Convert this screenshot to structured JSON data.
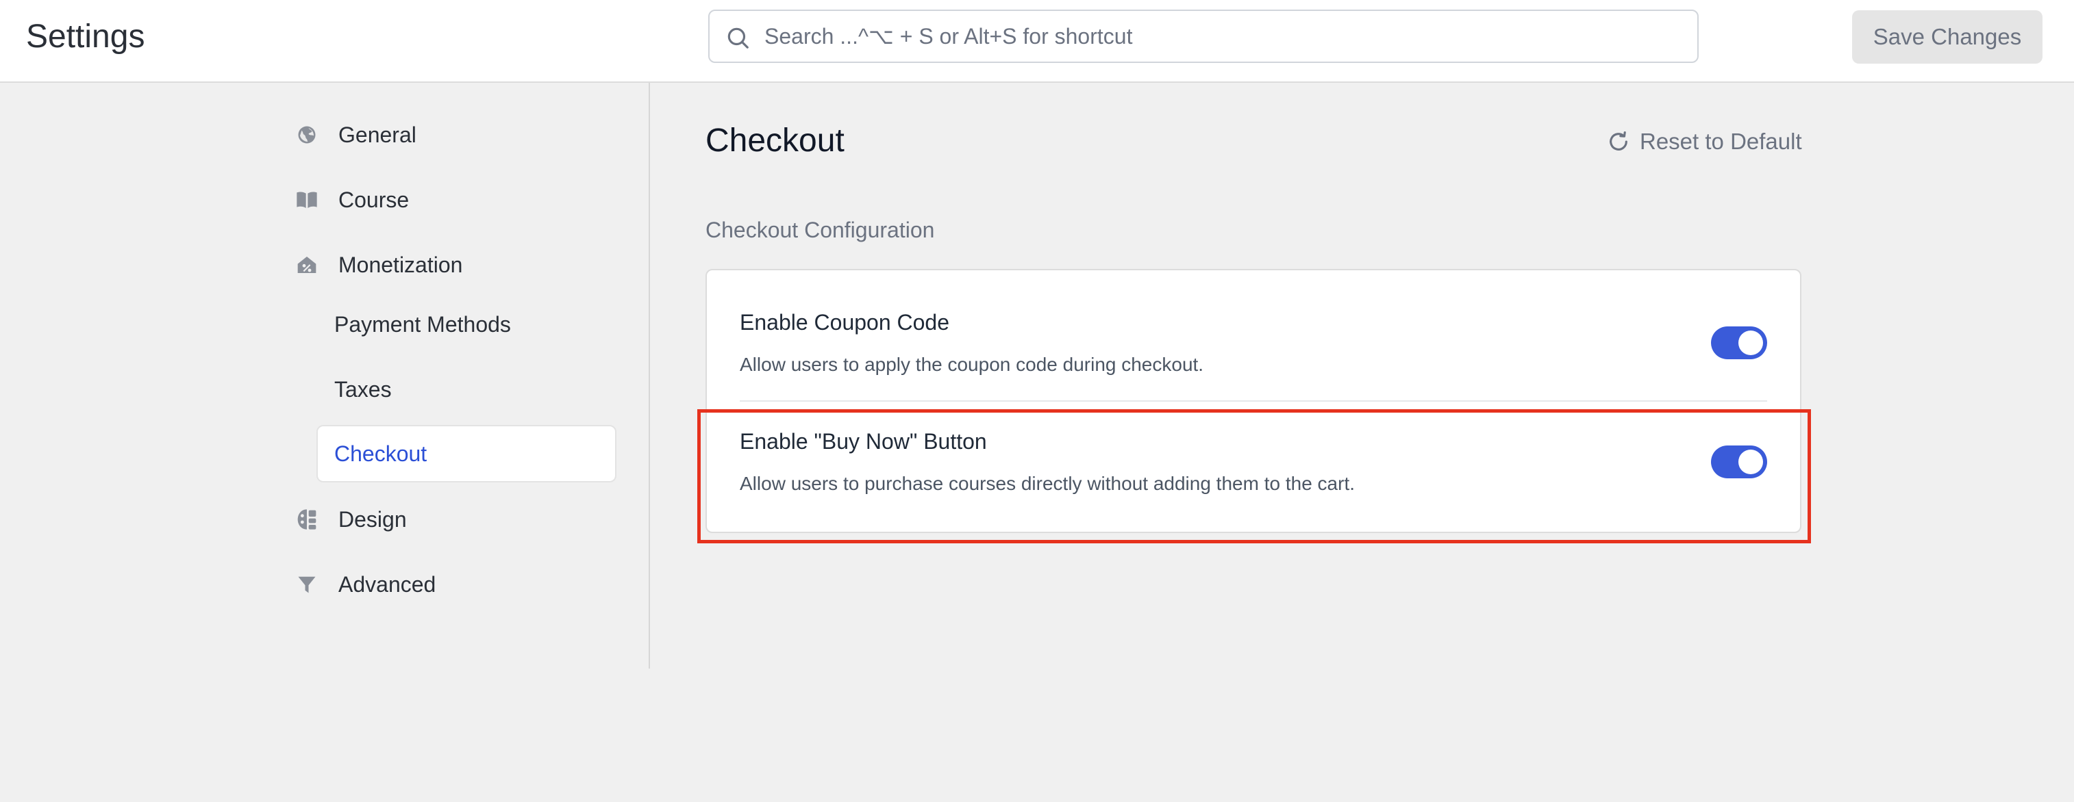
{
  "header": {
    "title": "Settings",
    "search_placeholder": "Search ...^⌥ + S or Alt+S for shortcut",
    "save_label": "Save Changes"
  },
  "sidebar": {
    "items": [
      {
        "label": "General",
        "icon": "globe-icon"
      },
      {
        "label": "Course",
        "icon": "book-icon"
      },
      {
        "label": "Monetization",
        "icon": "monetization-icon"
      },
      {
        "label": "Payment Methods"
      },
      {
        "label": "Taxes"
      },
      {
        "label": "Checkout",
        "active": true
      },
      {
        "label": "Design",
        "icon": "palette-icon"
      },
      {
        "label": "Advanced",
        "icon": "filter-icon"
      }
    ]
  },
  "main": {
    "title": "Checkout",
    "reset_label": "Reset to Default",
    "section_heading": "Checkout Configuration",
    "settings": [
      {
        "title": "Enable Coupon Code",
        "description": "Allow users to apply the coupon code during checkout.",
        "enabled": true
      },
      {
        "title": "Enable \"Buy Now\" Button",
        "description": "Allow users to purchase courses directly without adding them to the cart.",
        "enabled": true
      }
    ]
  },
  "colors": {
    "accent": "#3a5bd9",
    "active_nav": "#2b4fd6",
    "highlight": "#e6321e"
  }
}
